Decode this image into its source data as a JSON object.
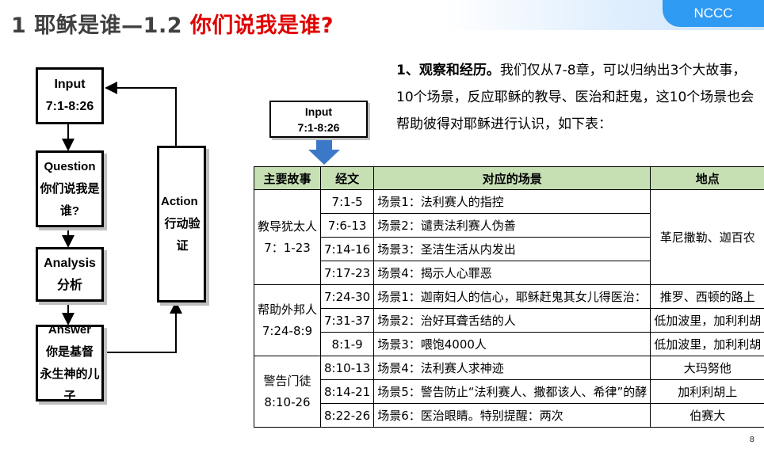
{
  "header": {
    "title_part1": "1 耶稣是谁—1.2 ",
    "title_part2": "你们说我是谁?",
    "brand": "NCCC"
  },
  "flowchart": {
    "input_line1": "Input",
    "input_line2": "7:1-8:26",
    "question_line1": "Question",
    "question_line2": "你们说我是谁?",
    "analysis_line1": "Analysis",
    "analysis_line2": "分析",
    "answer_line1": "Answer",
    "answer_line2": "你是基督",
    "answer_line3": "永生神的儿子",
    "action_line1": "Action",
    "action_line2": "行动验证"
  },
  "input_box": {
    "line1": "Input",
    "line2": "7:1-8:26"
  },
  "paragraph": {
    "lead": "1、观察和经历。",
    "text": "我们仅从7-8章，可以归纳出3个大故事，10个场景，反应耶稣的教导、医治和赶鬼，这10个场景也会帮助彼得对耶稣进行认识，如下表："
  },
  "table": {
    "headers": [
      "主要故事",
      "经文",
      "对应的场景",
      "地点"
    ],
    "groups": [
      {
        "story_line1": "教导犹太人",
        "story_line2": "7：1-23",
        "place": "革尼撒勒、迦百农",
        "rows": [
          {
            "verse": "7:1-5",
            "scene": "场景1：法利赛人的指控"
          },
          {
            "verse": "7:6-13",
            "scene": "场景2：谴责法利赛人伪善"
          },
          {
            "verse": "7:14-16",
            "scene": "场景3：圣洁生活从内发出"
          },
          {
            "verse": "7:17-23",
            "scene": "场景4：揭示人心罪恶"
          }
        ]
      },
      {
        "story_line1": "帮助外邦人",
        "story_line2": "7:24-8:9",
        "rows": [
          {
            "verse": "7:24-30",
            "scene": "场景1：迦南妇人的信心，耶稣赶鬼其女儿得医治：",
            "place": "推罗、西顿的路上"
          },
          {
            "verse": "7:31-37",
            "scene": "场景2：治好耳聋舌结的人",
            "place": "低加波里，加利利胡"
          },
          {
            "verse": "8:1-9",
            "scene": "场景3：喂饱4000人",
            "place": "低加波里，加利利胡"
          }
        ]
      },
      {
        "story_line1": "警告门徒",
        "story_line2": "8:10-26",
        "rows": [
          {
            "verse": "8:10-13",
            "scene": "场景4：法利赛人求神迹",
            "place": "大玛努他"
          },
          {
            "verse": "8:14-21",
            "scene": "场景5：警告防止“法利赛人、撒都该人、希律”的酵",
            "place": "加利利胡上"
          },
          {
            "verse": "8:22-26",
            "scene": "场景6：医治眼睛。特别提醒：两次",
            "place": "伯赛大"
          }
        ]
      }
    ]
  },
  "page_number": "8",
  "colors": {
    "title_red": "#e00000",
    "title_gray": "#404040",
    "brand_blue": "#2f9af2",
    "header_green": "#c6e0b4",
    "arrow_blue": "#3c78c8"
  }
}
